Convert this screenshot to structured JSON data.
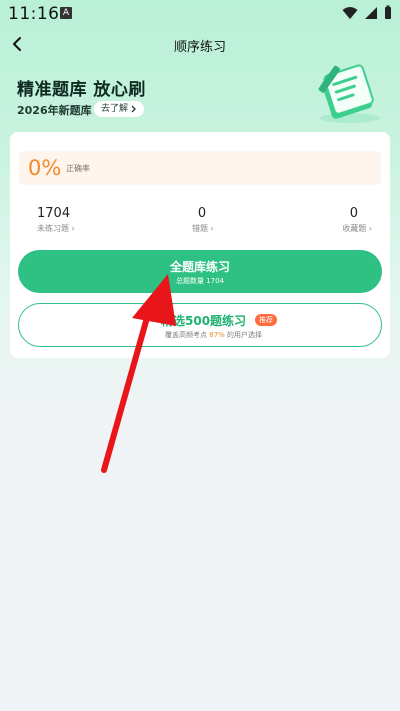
{
  "status_bar": {
    "time": "11:16",
    "app_icon_letter": "A"
  },
  "header": {
    "title": "顺序练习"
  },
  "banner": {
    "title": "精准题库 放心刷",
    "subtitle": "2026年新题库",
    "learn_more": "去了解"
  },
  "stats": {
    "accuracy_value": "0%",
    "accuracy_label": "正确率",
    "items": [
      {
        "value": "1704",
        "label": "未练习题"
      },
      {
        "value": "0",
        "label": "错题"
      },
      {
        "value": "0",
        "label": "收藏题"
      }
    ]
  },
  "actions": {
    "full_practice": {
      "title": "全题库练习",
      "subtitle": "总题数量 1704"
    },
    "select_practice": {
      "title": "精选500题练习",
      "badge": "推荐",
      "sub_prefix": "覆盖高频考点",
      "sub_highlight": "87%",
      "sub_suffix": "的用户选择"
    }
  },
  "colors": {
    "accent": "#2fc083",
    "orange": "#f28a2c",
    "annotation_arrow": "#e8161b"
  }
}
